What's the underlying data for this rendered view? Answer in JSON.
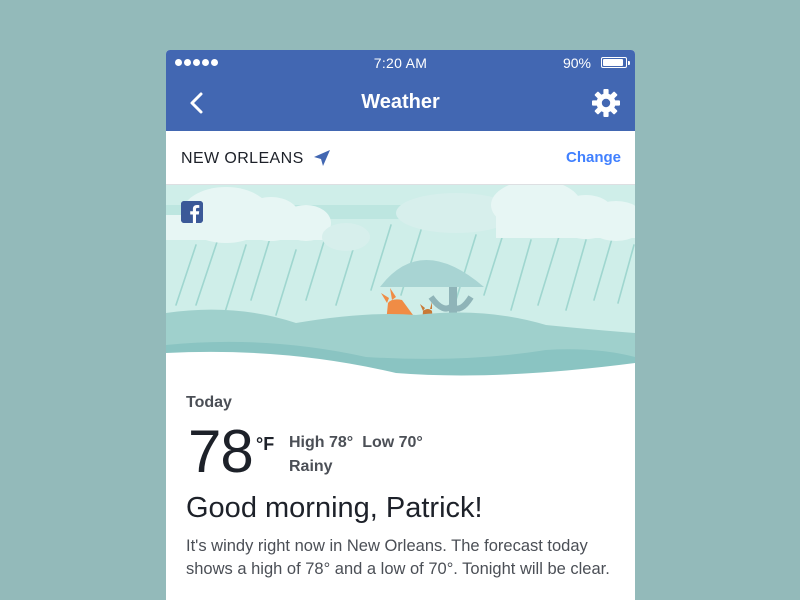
{
  "status_bar": {
    "signal_dots": 5,
    "time": "7:20 AM",
    "battery_percent": "90%",
    "battery_level": 0.9
  },
  "nav": {
    "back_icon": "chevron-left-icon",
    "title": "Weather",
    "settings_icon": "gear-icon",
    "color": "#4267b2"
  },
  "location": {
    "name": "NEW ORLEANS",
    "icon": "location-arrow-icon",
    "change_label": "Change",
    "change_color": "#4080ff"
  },
  "illustration": {
    "scene": "rain",
    "logo_icon": "facebook-logo-icon"
  },
  "weather": {
    "day_label": "Today",
    "temperature": "78",
    "unit": "°F",
    "high": "High 78°",
    "low": "Low 70°",
    "condition": "Rainy"
  },
  "greeting": "Good morning, Patrick!",
  "forecast_text": "It's windy right now in New Orleans. The forecast today shows a high of 78° and a low of 70°. Tonight will be clear."
}
